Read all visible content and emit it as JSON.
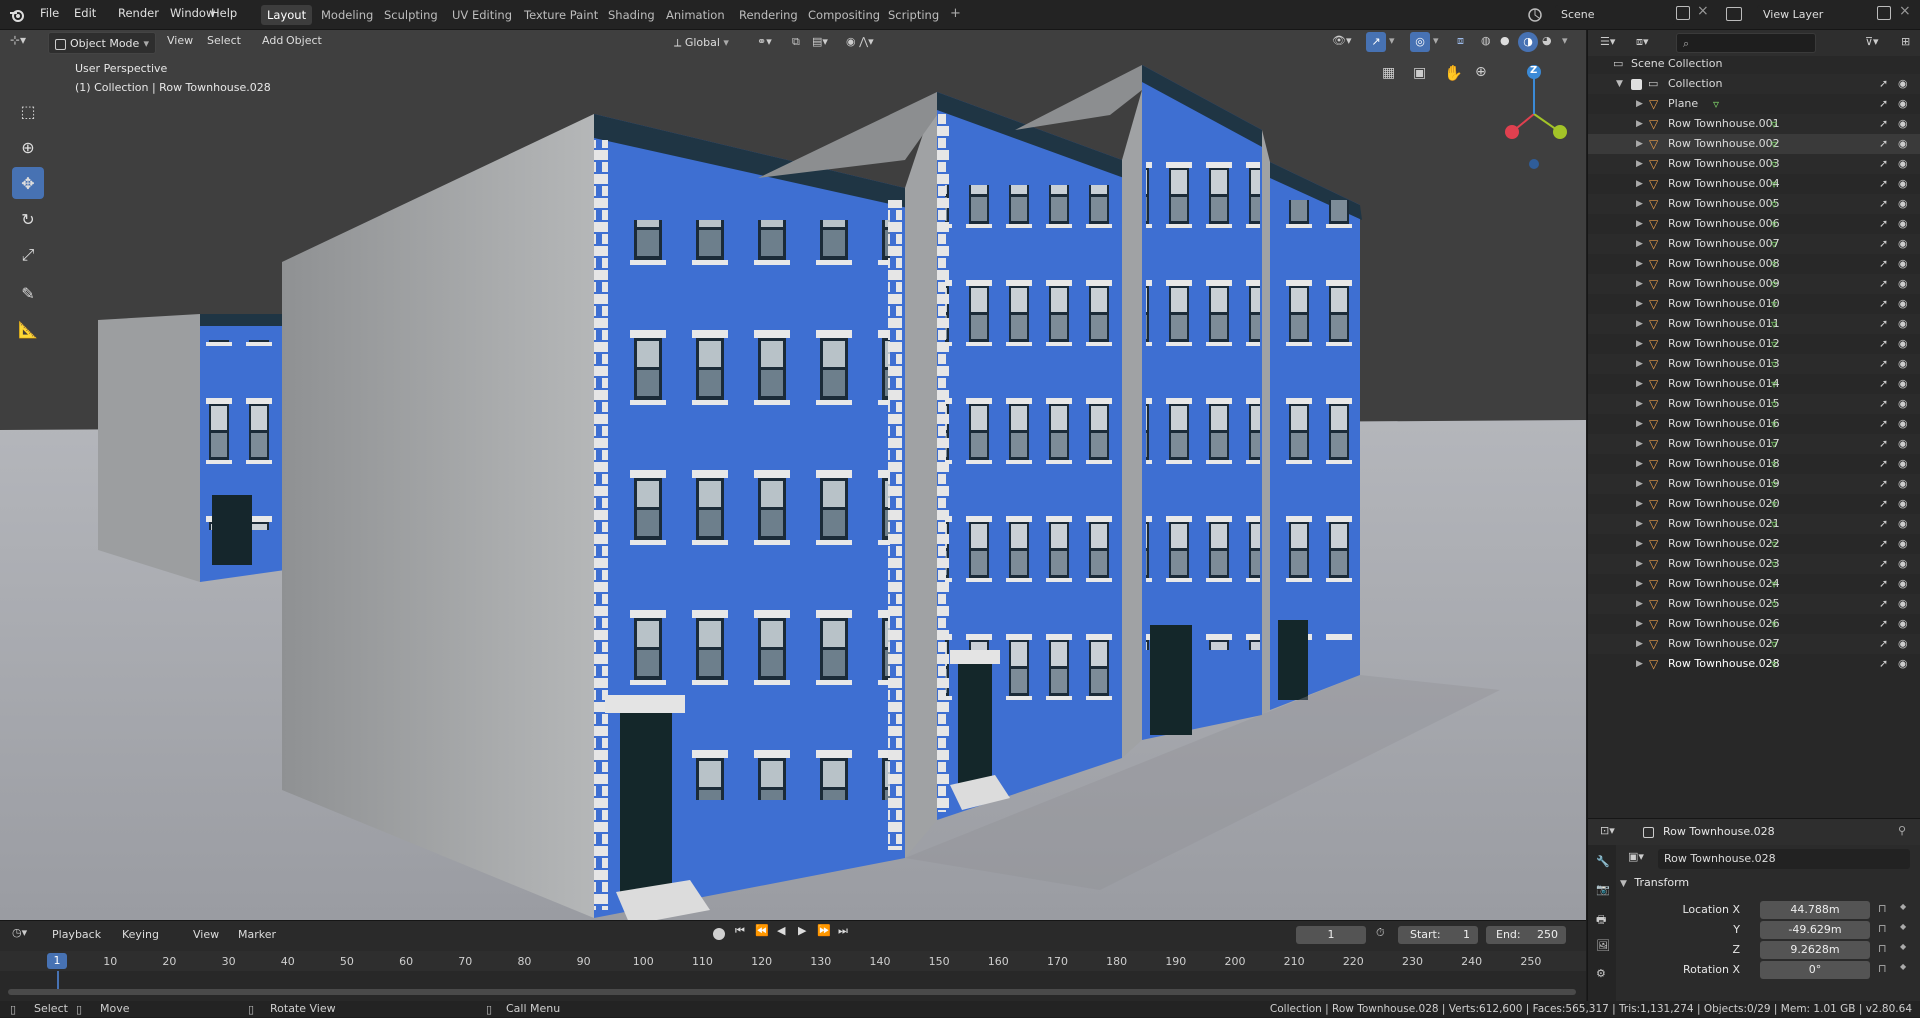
{
  "topbar": {
    "menus": [
      "File",
      "Edit",
      "Render",
      "Window",
      "Help"
    ],
    "workspaces": [
      "Layout",
      "Modeling",
      "Sculpting",
      "UV Editing",
      "Texture Paint",
      "Shading",
      "Animation",
      "Rendering",
      "Compositing",
      "Scripting"
    ],
    "active_workspace": "Layout",
    "add_workspace": "+",
    "scene": "Scene",
    "view_layer": "View Layer"
  },
  "viewport_header": {
    "mode": "Object Mode",
    "menus": [
      "View",
      "Select",
      "Add",
      "Object"
    ],
    "orientation": "Global"
  },
  "viewport": {
    "overlay_line1": "User Perspective",
    "overlay_line2": "(1) Collection | Row Townhouse.028",
    "gizmo_z": "Z",
    "colors": {
      "x_axis": "#e0404f",
      "y_axis": "#a3c428",
      "z_axis": "#3b8ad6",
      "brick": "#3e6fd2",
      "concrete": "#a3a5a6",
      "floor": "#a6a8ad",
      "bg": "#3f3f3f"
    }
  },
  "tools": [
    "select-box-icon",
    "cursor-icon",
    "move-icon",
    "rotate-icon",
    "scale-icon",
    "annotate-icon",
    "measure-icon"
  ],
  "outliner": {
    "search_placeholder": "",
    "scene_collection": "Scene Collection",
    "collection": "Collection",
    "items": [
      "Plane",
      "Row Townhouse.001",
      "Row Townhouse.002",
      "Row Townhouse.003",
      "Row Townhouse.004",
      "Row Townhouse.005",
      "Row Townhouse.006",
      "Row Townhouse.007",
      "Row Townhouse.008",
      "Row Townhouse.009",
      "Row Townhouse.010",
      "Row Townhouse.011",
      "Row Townhouse.012",
      "Row Townhouse.013",
      "Row Townhouse.014",
      "Row Townhouse.015",
      "Row Townhouse.016",
      "Row Townhouse.017",
      "Row Townhouse.018",
      "Row Townhouse.019",
      "Row Townhouse.020",
      "Row Townhouse.021",
      "Row Townhouse.022",
      "Row Townhouse.023",
      "Row Townhouse.024",
      "Row Townhouse.025",
      "Row Townhouse.026",
      "Row Townhouse.027",
      "Row Townhouse.028"
    ],
    "active_item": "Row Townhouse.028",
    "highlight_item": "Row Townhouse.002"
  },
  "properties": {
    "header_object": "Row Townhouse.028",
    "name_field": "Row Townhouse.028",
    "panel": "Transform",
    "rows": [
      {
        "label": "Location X",
        "value": "44.788m"
      },
      {
        "label": "Y",
        "value": "-49.629m"
      },
      {
        "label": "Z",
        "value": "9.2628m"
      },
      {
        "label": "Rotation X",
        "value": "0°"
      }
    ]
  },
  "timeline": {
    "menus": [
      "Playback",
      "Keying",
      "View",
      "Marker"
    ],
    "current_frame": "1",
    "start_label": "Start:",
    "start": "1",
    "end_label": "End:",
    "end": "250",
    "ruler": [
      "1",
      "10",
      "20",
      "30",
      "40",
      "50",
      "60",
      "70",
      "80",
      "90",
      "100",
      "110",
      "120",
      "130",
      "140",
      "150",
      "160",
      "170",
      "180",
      "190",
      "200",
      "210",
      "220",
      "230",
      "240",
      "250"
    ]
  },
  "statusbar": {
    "select": "Select",
    "move": "Move",
    "rotate": "Rotate View",
    "call_menu": "Call Menu",
    "info": "Collection | Row Townhouse.028 | Verts:612,600 | Faces:565,317 | Tris:1,131,274 | Objects:0/29 | Mem: 1.01 GB | v2.80.64"
  }
}
